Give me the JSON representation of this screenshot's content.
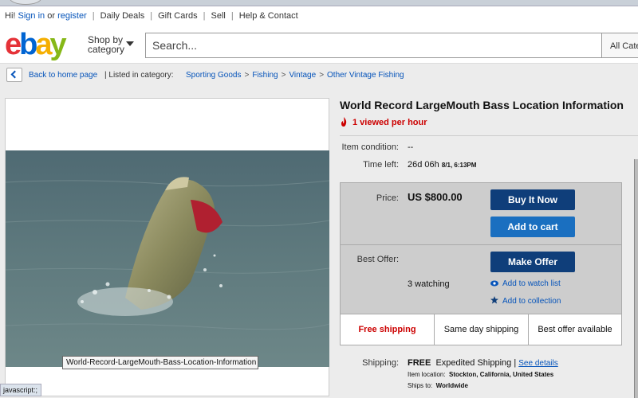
{
  "userbar": {
    "greeting": "Hi!",
    "sign_in": "Sign in",
    "or": "or",
    "register": "register",
    "daily_deals": "Daily Deals",
    "gift_cards": "Gift Cards",
    "sell": "Sell",
    "help_contact": "Help & Contact"
  },
  "header": {
    "logo_e": "e",
    "logo_b": "b",
    "logo_a": "a",
    "logo_y": "y",
    "shop_by_line1": "Shop by",
    "shop_by_line2": "category",
    "search_placeholder": "Search...",
    "all_categories": "All Cate"
  },
  "breadcrumb": {
    "back": "Back to home page",
    "listed": "| Listed in category:",
    "items": [
      "Sporting Goods",
      "Fishing",
      "Vintage",
      "Other Vintage Fishing"
    ],
    "separator": ">"
  },
  "image": {
    "tooltip": "World-Record-LargeMouth-Bass-Location-Information",
    "status": "javascript:;"
  },
  "listing": {
    "title": "World Record LargeMouth Bass Location Information",
    "viewed": "1 viewed per hour",
    "condition_label": "Item condition:",
    "condition_value": "--",
    "time_left_label": "Time left:",
    "time_left_value": "26d 06h",
    "time_left_date": "8/1, 6:13PM",
    "price_label": "Price:",
    "price_value": "US $800.00",
    "buy_now": "Buy It Now",
    "add_to_cart": "Add to cart",
    "best_offer_label": "Best Offer:",
    "make_offer": "Make Offer",
    "watching": "3 watching",
    "add_watch": "Add to watch list",
    "add_collection": "Add to collection",
    "free_shipping": "Free shipping",
    "same_day": "Same day shipping",
    "best_offer_available": "Best offer available",
    "shipping_label": "Shipping:",
    "shipping_free": "FREE",
    "shipping_method": "Expedited Shipping |",
    "see_details": "See details",
    "item_location_label": "Item location:",
    "item_location_value": "Stockton, California, United States",
    "ships_to_label": "Ships to:",
    "ships_to_value": "Worldwide"
  },
  "colors": {
    "link": "#0654ba",
    "button_dark": "#0f3e7a",
    "button_light": "#1a6fc0",
    "alert": "#cc0000"
  }
}
